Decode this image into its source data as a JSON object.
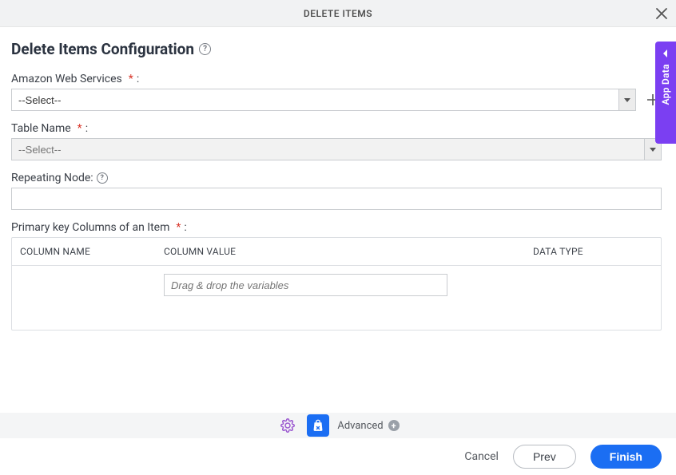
{
  "header": {
    "title": "DELETE ITEMS"
  },
  "page_title": "Delete Items Configuration",
  "fields": {
    "aws": {
      "label": "Amazon Web Services",
      "value": "--Select--"
    },
    "table_name": {
      "label": "Table Name",
      "placeholder": "--Select--"
    },
    "repeating_node": {
      "label": "Repeating Node:",
      "value": ""
    },
    "primary_key": {
      "label": "Primary key Columns of an Item",
      "columns": {
        "col_name": "COLUMN NAME",
        "col_value": "COLUMN VALUE",
        "data_type": "DATA TYPE"
      },
      "drop_placeholder": "Drag & drop the variables"
    }
  },
  "side_panel": {
    "label": "App Data"
  },
  "toolbar": {
    "advanced_label": "Advanced"
  },
  "footer": {
    "cancel": "Cancel",
    "prev": "Prev",
    "finish": "Finish"
  }
}
